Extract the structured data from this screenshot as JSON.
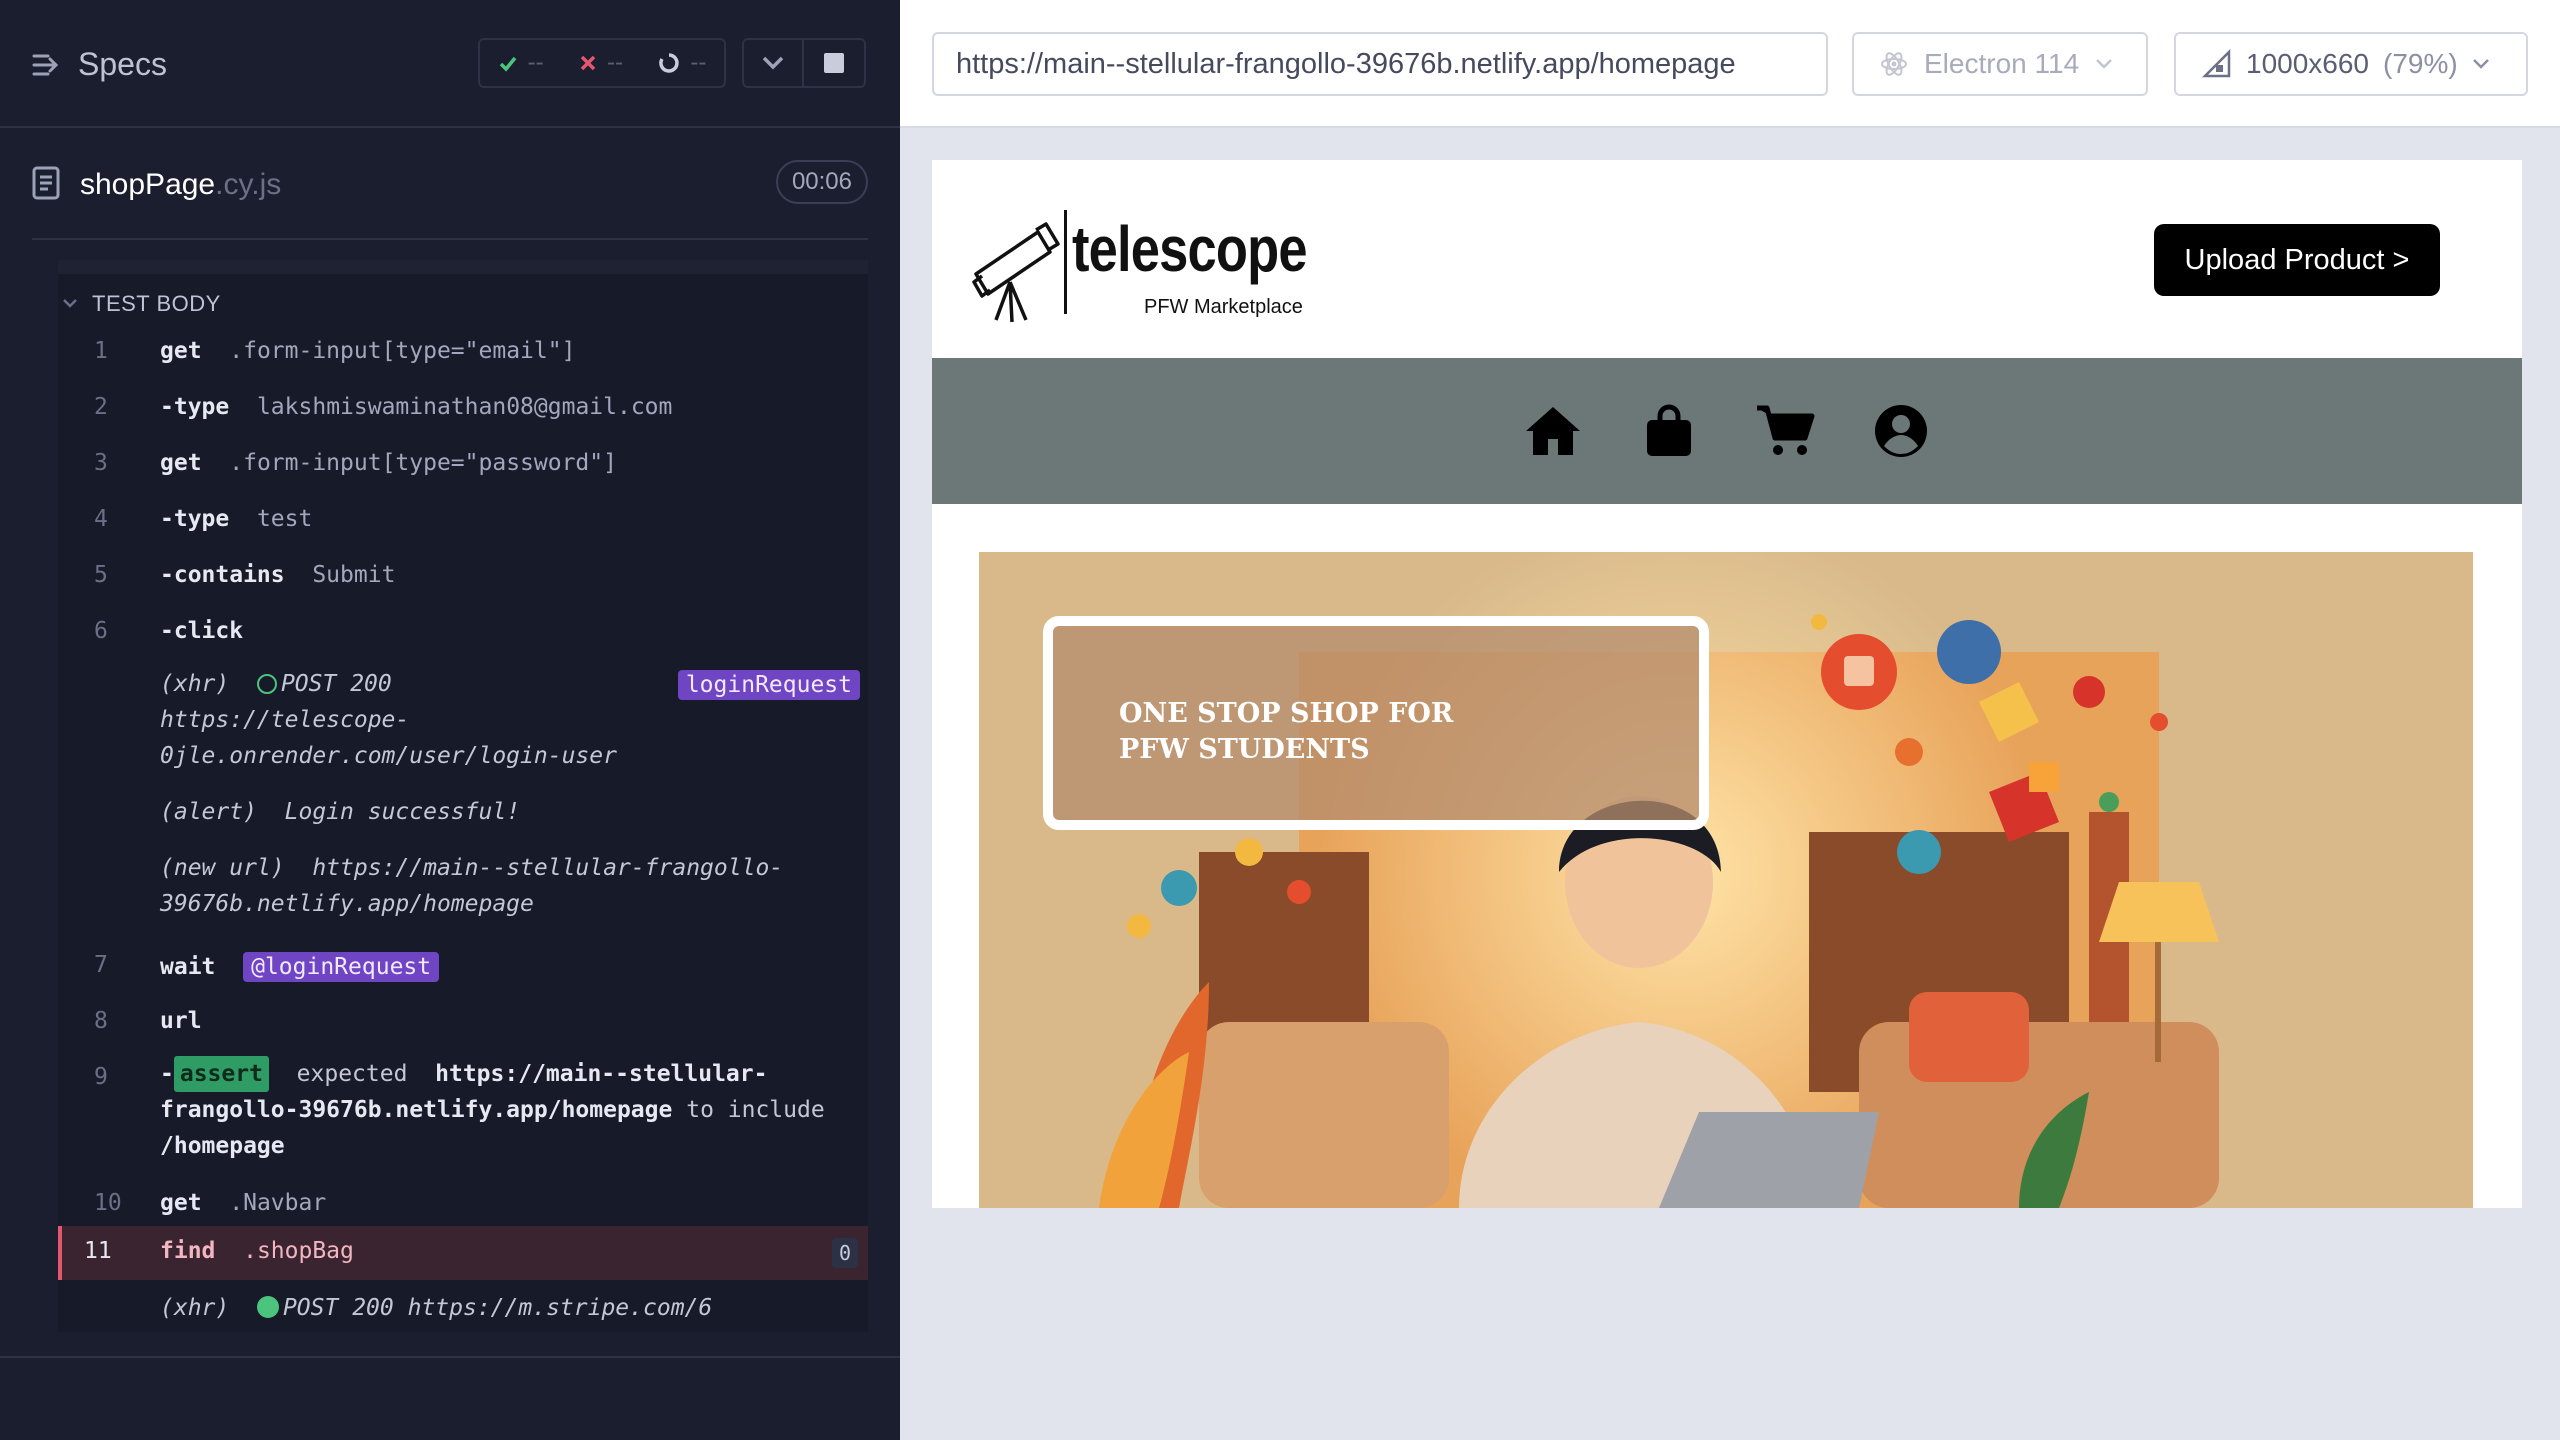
{
  "reporter": {
    "specs_label": "Specs",
    "stats": {
      "passed": "--",
      "failed": "--",
      "pending": "--"
    },
    "spec_file": "shopPage",
    "spec_ext": ".cy.js",
    "timer": "00:06",
    "section": "TEST BODY",
    "commands": [
      {
        "num": "1",
        "name": "get",
        "arg": ".form-input[type=\"email\"]"
      },
      {
        "num": "2",
        "name": "-type",
        "arg": "lakshmiswaminathan08@gmail.com"
      },
      {
        "num": "3",
        "name": "get",
        "arg": ".form-input[type=\"password\"]"
      },
      {
        "num": "4",
        "name": "-type",
        "arg": "test"
      },
      {
        "num": "5",
        "name": "-contains",
        "arg": "Submit"
      },
      {
        "num": "6",
        "name": "-click",
        "arg": ""
      },
      {
        "num": "7",
        "name": "wait",
        "arg": ""
      },
      {
        "num": "8",
        "name": "url",
        "arg": ""
      },
      {
        "num": "9",
        "name": "-",
        "arg": ""
      },
      {
        "num": "10",
        "name": "get",
        "arg": ".Navbar"
      },
      {
        "num": "11",
        "name": "find",
        "arg": ".shopBag"
      }
    ],
    "xhr1": {
      "type": "(xhr)",
      "status": "POST 200",
      "url_l1": "https://telescope-",
      "url_l2": "0jle.onrender.com/user/login-user",
      "alias": "loginRequest"
    },
    "alert": {
      "type": "(alert)",
      "msg": "Login successful!"
    },
    "newurl": {
      "type": "(new url)",
      "l1": "https://main--stellular-frangollo-",
      "l2": "39676b.netlify.app/homepage"
    },
    "wait_alias": "@loginRequest",
    "assert": {
      "tag": "assert",
      "expected": "expected",
      "url_a": "https://main--stellular-",
      "url_b": "frangollo-39676b.netlify.app/homepage",
      "to_include": "to include",
      "path": "/homepage"
    },
    "find_count": "0",
    "xhr2": {
      "type": "(xhr)",
      "status": "POST 200",
      "url": "https://m.stripe.com/6"
    }
  },
  "aut_bar": {
    "url": "https://main--stellular-frangollo-39676b.netlify.app/homepage",
    "browser": "Electron 114",
    "viewport": "1000x660",
    "scale": "(79%)"
  },
  "site": {
    "logo_word": "telescope",
    "logo_tagline": "PFW Marketplace",
    "upload_label": "Upload Product >",
    "nav_icons": [
      "home-icon",
      "shopping-bag-icon",
      "cart-icon",
      "account-icon"
    ],
    "hero_text_l1": "ONE STOP SHOP FOR",
    "hero_text_l2": "PFW STUDENTS"
  },
  "colors": {
    "reporter_bg": "#1b1e2e",
    "active_row": "#3a2430",
    "alias_purple": "#7045c4",
    "assert_green": "#2e9c64",
    "navbar": "#6c7878"
  }
}
